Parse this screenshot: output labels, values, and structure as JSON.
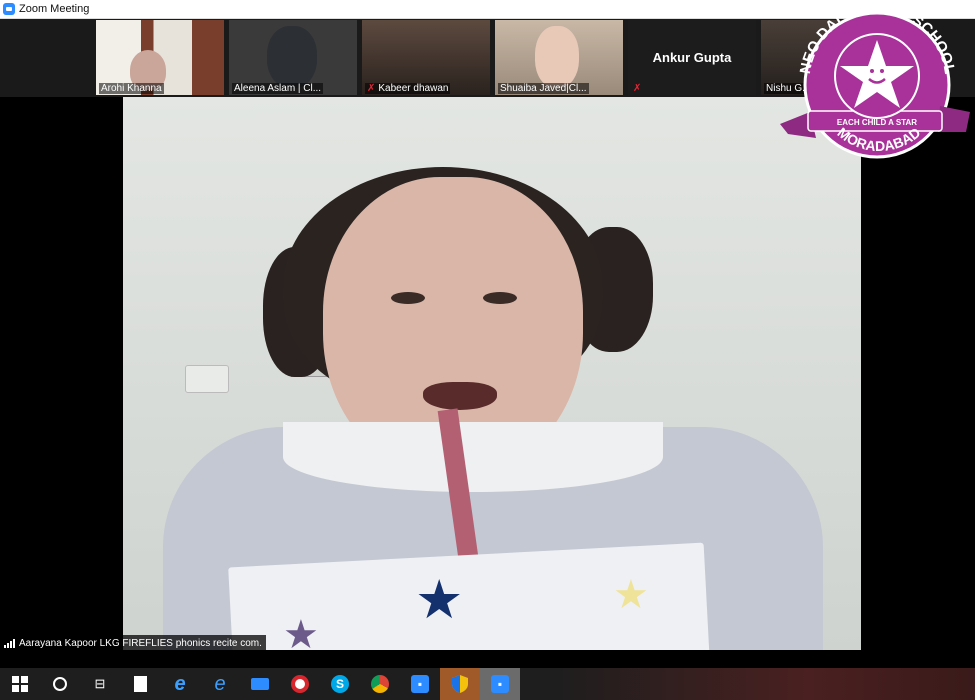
{
  "window": {
    "title": "Zoom Meeting"
  },
  "participants": [
    {
      "name": "Arohi Khanna",
      "muted": false,
      "video": true,
      "bg": "#5a3a2e"
    },
    {
      "name": "Aleena Aslam | Cl...",
      "muted": false,
      "video": true,
      "bg": "#3b3b3b"
    },
    {
      "name": "Kabeer dhawan",
      "muted": true,
      "video": true,
      "bg": "#3a2e27"
    },
    {
      "name": "Shuaiba Javed|Cl...",
      "muted": false,
      "video": true,
      "bg": "#8a7a6a"
    },
    {
      "name": "Ankur Gupta",
      "muted": true,
      "video": false,
      "bg": "#1a1a1a"
    },
    {
      "name": "Nishu G...",
      "muted": false,
      "video": true,
      "bg": "#2e2a27"
    }
  ],
  "active_speaker": {
    "label": "Aarayana Kapoor LKG FIREFLIES phonics recite  com."
  },
  "logo": {
    "top_text": "NEO DALES PLAY SCHOOL",
    "ribbon_text": "EACH CHILD A STAR",
    "bottom_text": "MORADABAD",
    "color": "#a8329a"
  },
  "taskbar": {
    "items": [
      {
        "name": "windows-start-icon"
      },
      {
        "name": "cortana-search-icon"
      },
      {
        "name": "task-view-icon"
      },
      {
        "name": "file-icon"
      },
      {
        "name": "edge-icon"
      },
      {
        "name": "internet-explorer-icon"
      },
      {
        "name": "mail-icon"
      },
      {
        "name": "opera-icon"
      },
      {
        "name": "skype-icon",
        "letter": "S"
      },
      {
        "name": "chrome-icon"
      },
      {
        "name": "zoom-icon"
      },
      {
        "name": "security-shield-icon"
      },
      {
        "name": "zoom-meeting-active-icon"
      }
    ]
  }
}
